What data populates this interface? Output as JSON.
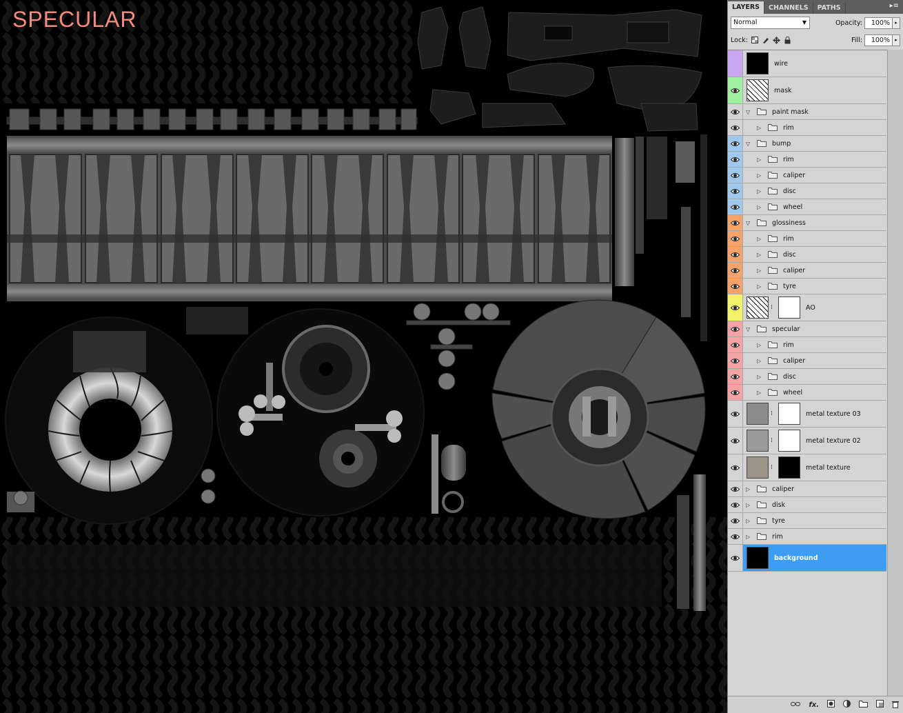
{
  "canvas": {
    "title": "SPECULAR",
    "title_color": "#f58b7f"
  },
  "panel": {
    "tabs": [
      {
        "label": "LAYERS",
        "active": true
      },
      {
        "label": "CHANNELS",
        "active": false
      },
      {
        "label": "PATHS",
        "active": false
      }
    ],
    "blend_mode": "Normal",
    "opacity_label": "Opacity:",
    "opacity_value": "100%",
    "lock_label": "Lock:",
    "fill_label": "Fill:",
    "fill_value": "100%",
    "lock_icons": [
      "lock-transparent-icon",
      "lock-paint-icon",
      "lock-move-icon",
      "lock-all-icon"
    ],
    "bottom_icons": [
      "link-icon",
      "fx-icon",
      "mask-icon",
      "adjustment-icon",
      "group-icon",
      "new-layer-icon",
      "trash-icon"
    ],
    "bottom_labels": {
      "fx": "fx."
    }
  },
  "layers": [
    {
      "name": "wire",
      "kind": "thumb",
      "color": "#c9a6f0",
      "eye": false,
      "thumb": "wire"
    },
    {
      "name": "mask",
      "kind": "thumb",
      "color": "#9ff09f",
      "eye": true,
      "thumb": "noise"
    },
    {
      "name": "paint mask",
      "kind": "group",
      "open": true,
      "color": "#d4d4d4",
      "eye": true,
      "indent": 0
    },
    {
      "name": "rim",
      "kind": "group",
      "open": false,
      "color": "#d4d4d4",
      "eye": true,
      "indent": 1
    },
    {
      "name": "bump",
      "kind": "group",
      "open": true,
      "color": "#9fc8ef",
      "eye": true,
      "indent": 0
    },
    {
      "name": "rim",
      "kind": "group",
      "open": false,
      "color": "#9fc8ef",
      "eye": true,
      "indent": 1
    },
    {
      "name": "caliper",
      "kind": "group",
      "open": false,
      "color": "#9fc8ef",
      "eye": true,
      "indent": 1
    },
    {
      "name": "disc",
      "kind": "group",
      "open": false,
      "color": "#9fc8ef",
      "eye": true,
      "indent": 1
    },
    {
      "name": "wheel",
      "kind": "group",
      "open": false,
      "color": "#9fc8ef",
      "eye": true,
      "indent": 1
    },
    {
      "name": "glossiness",
      "kind": "group",
      "open": true,
      "color": "#f6a36b",
      "eye": true,
      "indent": 0
    },
    {
      "name": "rim",
      "kind": "group",
      "open": false,
      "color": "#f6a36b",
      "eye": true,
      "indent": 1
    },
    {
      "name": "disc",
      "kind": "group",
      "open": false,
      "color": "#f6a36b",
      "eye": true,
      "indent": 1
    },
    {
      "name": "caliper",
      "kind": "group",
      "open": false,
      "color": "#f6a36b",
      "eye": true,
      "indent": 1
    },
    {
      "name": "tyre",
      "kind": "group",
      "open": false,
      "color": "#f6a36b",
      "eye": true,
      "indent": 1
    },
    {
      "name": "AO",
      "kind": "masked",
      "color": "#f3f36a",
      "eye": true,
      "thumb": "noise"
    },
    {
      "name": "specular",
      "kind": "group",
      "open": true,
      "color": "#f3a3a3",
      "eye": true,
      "indent": 0
    },
    {
      "name": "rim",
      "kind": "group",
      "open": false,
      "color": "#f3a3a3",
      "eye": true,
      "indent": 1
    },
    {
      "name": "caliper",
      "kind": "group",
      "open": false,
      "color": "#f3a3a3",
      "eye": true,
      "indent": 1
    },
    {
      "name": "disc",
      "kind": "group",
      "open": false,
      "color": "#f3a3a3",
      "eye": true,
      "indent": 1
    },
    {
      "name": "wheel",
      "kind": "group",
      "open": false,
      "color": "#f3a3a3",
      "eye": true,
      "indent": 1
    },
    {
      "name": "metal texture 03",
      "kind": "masked",
      "color": "#d4d4d4",
      "eye": true,
      "thumb": "metal"
    },
    {
      "name": "metal texture 02",
      "kind": "masked",
      "color": "#d4d4d4",
      "eye": true,
      "thumb": "metal2"
    },
    {
      "name": "metal texture",
      "kind": "masked",
      "color": "#d4d4d4",
      "eye": true,
      "thumb": "metal3"
    },
    {
      "name": "caliper",
      "kind": "group",
      "open": false,
      "color": "#d4d4d4",
      "eye": true,
      "indent": 0
    },
    {
      "name": "disk",
      "kind": "group",
      "open": false,
      "color": "#d4d4d4",
      "eye": true,
      "indent": 0
    },
    {
      "name": "tyre",
      "kind": "group",
      "open": false,
      "color": "#d4d4d4",
      "eye": true,
      "indent": 0
    },
    {
      "name": "rim",
      "kind": "group",
      "open": false,
      "color": "#d4d4d4",
      "eye": true,
      "indent": 0
    },
    {
      "name": "background",
      "kind": "thumb",
      "color": "#d4d4d4",
      "eye": true,
      "thumb": "black",
      "selected": true
    }
  ]
}
